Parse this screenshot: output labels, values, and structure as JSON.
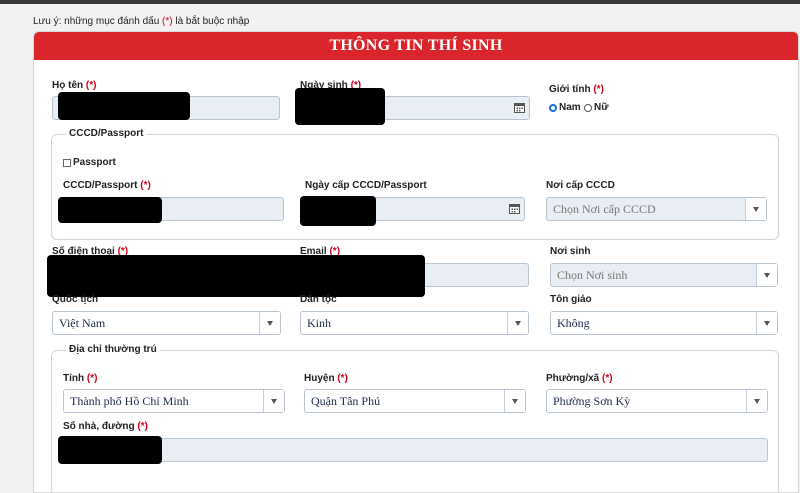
{
  "note": {
    "text_before": "Lưu ý: những mục đánh dấu ",
    "required_mark": "(*)",
    "text_after": " là bắt buộc nhập"
  },
  "form": {
    "title": "THÔNG TIN THÍ SINH",
    "required_mark": "(*)",
    "ho_ten": {
      "label": "Họ tên"
    },
    "ngay_sinh": {
      "label": "Ngày sinh"
    },
    "gioi_tinh": {
      "label": "Giới tính",
      "options": [
        "Nam",
        "Nữ"
      ],
      "selected": "Nam"
    },
    "cccd_group": {
      "legend": "CCCD/Passport",
      "passport_checkbox": "Passport",
      "cccd": {
        "label": "CCCD/Passport"
      },
      "ngay_cap": {
        "label": "Ngày cấp CCCD/Passport"
      },
      "noi_cap": {
        "label": "Nơi cấp CCCD",
        "placeholder": "Chọn Nơi cấp CCCD"
      }
    },
    "so_dien_thoai": {
      "label": "Số điện thoại"
    },
    "email": {
      "label": "Email"
    },
    "noi_sinh": {
      "label": "Nơi sinh",
      "placeholder": "Chọn Nơi sinh"
    },
    "quoc_tich": {
      "label": "Quốc tịch",
      "value": "Việt Nam"
    },
    "dan_toc": {
      "label": "Dân tộc",
      "value": "Kinh"
    },
    "ton_giao": {
      "label": "Tôn giáo",
      "value": "Không"
    },
    "dia_chi": {
      "legend": "Địa chỉ thường trú",
      "tinh": {
        "label": "Tỉnh",
        "value": "Thành phố Hồ Chí Minh"
      },
      "huyen": {
        "label": "Huyện",
        "value": "Quận Tân Phú"
      },
      "phuong": {
        "label": "Phường/xã",
        "value": "Phường Sơn Kỳ"
      },
      "so_nha": {
        "label": "Số nhà, đường"
      }
    }
  },
  "colors": {
    "header": "#d9252b",
    "required": "#d0021b",
    "field_bg": "#e9eef5",
    "radio_selected": "#1a6fd6"
  }
}
